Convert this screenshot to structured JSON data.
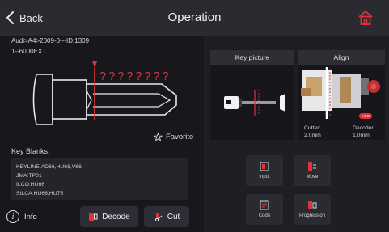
{
  "header": {
    "back_label": "Back",
    "title": "Operation"
  },
  "key": {
    "path": "Audi>A4>2009-0---ID:1309",
    "code": "1--6000EXT",
    "unknown_cuts": "????????",
    "favorite_label": "Favorite"
  },
  "key_blanks": {
    "title": "Key Blanks:",
    "lines": [
      "KEYLINE:AD66,HU66,V66",
      "JMA:TP01",
      "ILCO:HU66",
      "SILCA:HU66,HU75"
    ]
  },
  "bottom": {
    "info_label": "Info",
    "decode_label": "Decode",
    "cut_label": "Cut"
  },
  "tabs": {
    "key_picture": "Key picture",
    "align": "Align"
  },
  "align": {
    "badge": "A1-B",
    "cutter_label": "Cutter:",
    "cutter_value": "2.0mm",
    "decoder_label": "Decoder:",
    "decoder_value": "1.0mm"
  },
  "actions": {
    "input": "Input",
    "move": "Move",
    "code": "Code",
    "progression": "Progression"
  },
  "colors": {
    "accent": "#e0323c",
    "header_bg": "#2a2a31",
    "panel_bg": "#1e1e24"
  }
}
